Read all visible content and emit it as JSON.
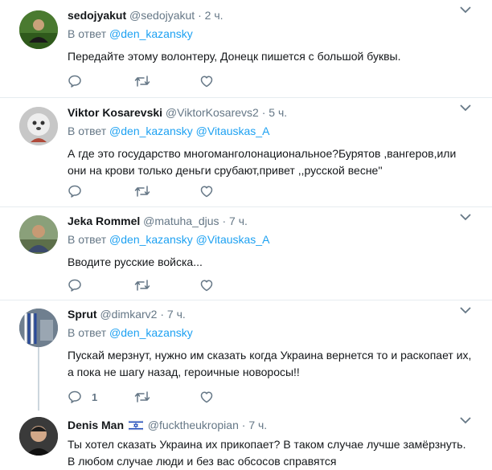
{
  "tweets": [
    {
      "name": "sedojyakut",
      "handle": "@sedojyakut",
      "time": "2 ч.",
      "reply_prefix": "В ответ",
      "mentions": [
        "@den_kazansky"
      ],
      "text": "Передайте этому волонтеру, Донецк пишется с большой буквы.",
      "reply_count": "",
      "icons": [
        "reply-icon",
        "retweet-icon",
        "like-icon",
        "chevron-down-icon"
      ]
    },
    {
      "name": "Viktor Kosarevski",
      "handle": "@ViktorKosarevs2",
      "time": "5 ч.",
      "reply_prefix": "В ответ",
      "mentions": [
        "@den_kazansky",
        "@Vitauskas_A"
      ],
      "text": "А где это государство многоманголонациональное?Бурятов ,вангеров,или они на крови только деньги срубают,привет ,,русской весне''",
      "reply_count": ""
    },
    {
      "name": "Jeka Rommel",
      "handle": "@matuha_djus",
      "time": "7 ч.",
      "reply_prefix": "В ответ",
      "mentions": [
        "@den_kazansky",
        "@Vitauskas_A"
      ],
      "text": "Вводите русские войска...",
      "reply_count": ""
    },
    {
      "name": "Sprut",
      "handle": "@dimkarv2",
      "time": "7 ч.",
      "reply_prefix": "В ответ",
      "mentions": [
        "@den_kazansky"
      ],
      "text": "Пускай мерзнут, нужно им сказать когда Украина вернется то и раскопает их, а пока не шагу назад, героичные новоросы!!",
      "reply_count": "1"
    },
    {
      "name": "Denis Man",
      "handle": "@fucktheukropian",
      "time": "7 ч.",
      "text": "Ты хотел сказать Украина их прикопает? В таком случае лучше замёрзнуть. В любом случае люди и без вас обсосов справятся",
      "flag": "israel-flag-icon"
    }
  ],
  "colors": {
    "link": "#1da1f2",
    "secondary_text": "#657786",
    "divider": "#e6ecf0",
    "thread_line": "#ccd6dd"
  }
}
